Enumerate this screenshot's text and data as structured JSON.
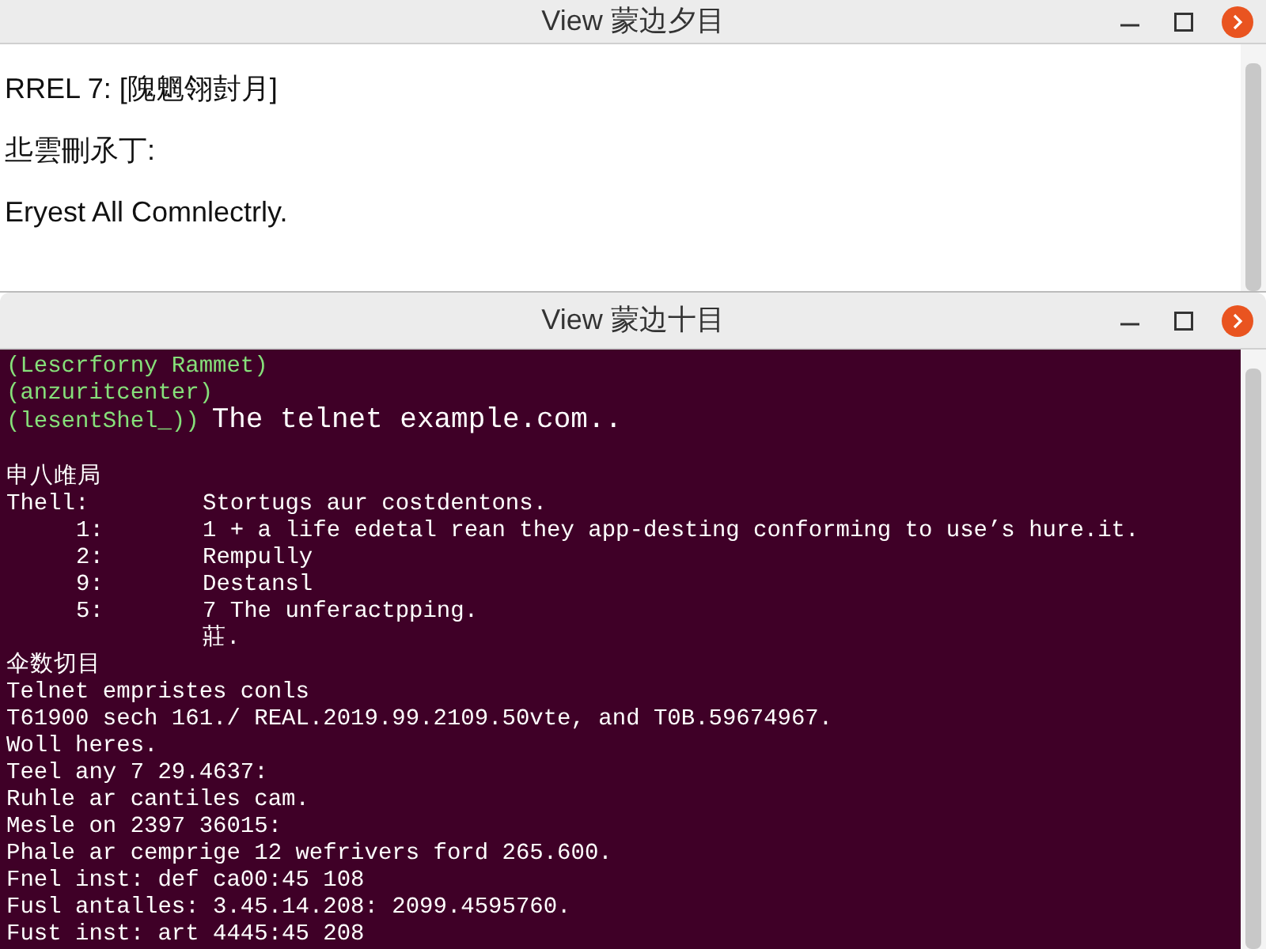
{
  "windows": [
    {
      "title": "View 蒙边夕目",
      "lines": [
        "RREL 7: [隗魍翎尌月]",
        "丠雲刪氶丁:",
        "Eryest All Comnlectrly."
      ]
    },
    {
      "title": "View 蒙边十目",
      "terminal": [
        {
          "kind": "green",
          "text": "(Lescrforny Rammet)"
        },
        {
          "kind": "green",
          "text": "(anzuritcenter)"
        },
        {
          "kind": "prompt",
          "prompt": "(lesentShel_))",
          "command": "The telnet example.com.."
        },
        {
          "kind": "gap"
        },
        {
          "kind": "plain",
          "text": "申八䧳局"
        },
        {
          "kind": "item",
          "label": "Thell:",
          "text": "Stortugs aur costdentons."
        },
        {
          "kind": "item",
          "label": "1:",
          "text": "1 + a life edetal rean they app-desting conforming to use’s hure.it."
        },
        {
          "kind": "item",
          "label": "2:",
          "text": "Rempully"
        },
        {
          "kind": "item",
          "label": "9:",
          "text": "Destansl"
        },
        {
          "kind": "item",
          "label": "5:",
          "text": "7 The unferactpping."
        },
        {
          "kind": "item",
          "text": "莊."
        },
        {
          "kind": "plain",
          "text": "伞数切目"
        },
        {
          "kind": "plain",
          "text": "Telnet empristes conls"
        },
        {
          "kind": "plain",
          "text": "T61900 sech 161./ REAL.2019.99.2109.50vte, and T0B.59674967."
        },
        {
          "kind": "plain",
          "text": "Woll heres."
        },
        {
          "kind": "plain",
          "text": "Teel any 7 29.4637:"
        },
        {
          "kind": "plain",
          "text": "Ruhle ar cantiles cam."
        },
        {
          "kind": "plain",
          "text": "Mesle on 2397 36015:"
        },
        {
          "kind": "plain",
          "text": "Phale ar cemprige 12 wefrivers ford 265.600."
        },
        {
          "kind": "plain",
          "text": "Fnel inst: def ca00:45 108"
        },
        {
          "kind": "plain",
          "text": "Fusl antalles: 3.45.14.208: 2099.4595760."
        },
        {
          "kind": "plain",
          "text": "Fust inst: art 4445:45 208"
        }
      ]
    }
  ]
}
